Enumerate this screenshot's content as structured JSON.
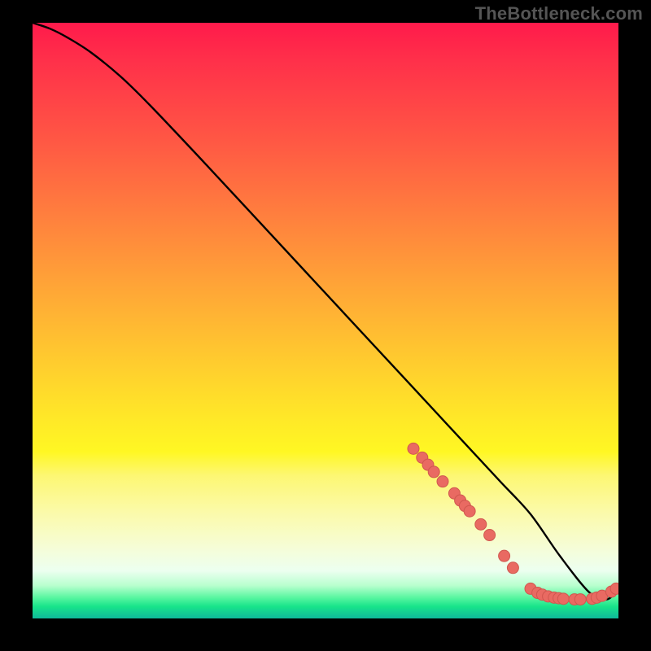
{
  "watermark": "TheBottleneck.com",
  "colors": {
    "background": "#000000",
    "curve_stroke": "#000000",
    "marker_fill": "#e96a62",
    "marker_stroke": "#d0574f"
  },
  "chart_data": {
    "type": "line",
    "title": "",
    "xlabel": "",
    "ylabel": "",
    "xlim": [
      0,
      100
    ],
    "ylim": [
      0,
      100
    ],
    "grid": false,
    "legend": false,
    "series": [
      {
        "name": "bottleneck-curve",
        "x": [
          0,
          3,
          6,
          10,
          15,
          20,
          30,
          40,
          50,
          60,
          65,
          70,
          75,
          80,
          85,
          90,
          95,
          98,
          100
        ],
        "y": [
          100,
          99,
          97.5,
          95,
          91,
          86.2,
          75.8,
          65.2,
          54.6,
          44,
          38.7,
          33.4,
          28.1,
          22.8,
          17.5,
          10.5,
          4.4,
          3.2,
          5.0
        ]
      }
    ],
    "markers": [
      {
        "x": 65.0,
        "y": 28.5
      },
      {
        "x": 66.5,
        "y": 27.0
      },
      {
        "x": 67.5,
        "y": 25.8
      },
      {
        "x": 68.5,
        "y": 24.6
      },
      {
        "x": 70.0,
        "y": 23.0
      },
      {
        "x": 72.0,
        "y": 21.0
      },
      {
        "x": 73.0,
        "y": 19.8
      },
      {
        "x": 73.8,
        "y": 18.9
      },
      {
        "x": 74.6,
        "y": 18.0
      },
      {
        "x": 76.5,
        "y": 15.8
      },
      {
        "x": 78.0,
        "y": 14.0
      },
      {
        "x": 80.5,
        "y": 10.5
      },
      {
        "x": 82.0,
        "y": 8.5
      },
      {
        "x": 85.0,
        "y": 5.0
      },
      {
        "x": 86.2,
        "y": 4.3
      },
      {
        "x": 87.0,
        "y": 4.0
      },
      {
        "x": 88.0,
        "y": 3.7
      },
      {
        "x": 89.0,
        "y": 3.5
      },
      {
        "x": 89.8,
        "y": 3.4
      },
      {
        "x": 90.6,
        "y": 3.3
      },
      {
        "x": 92.5,
        "y": 3.2
      },
      {
        "x": 93.5,
        "y": 3.2
      },
      {
        "x": 95.5,
        "y": 3.3
      },
      {
        "x": 96.3,
        "y": 3.5
      },
      {
        "x": 97.2,
        "y": 3.8
      },
      {
        "x": 98.8,
        "y": 4.5
      },
      {
        "x": 99.6,
        "y": 5.0
      }
    ]
  }
}
